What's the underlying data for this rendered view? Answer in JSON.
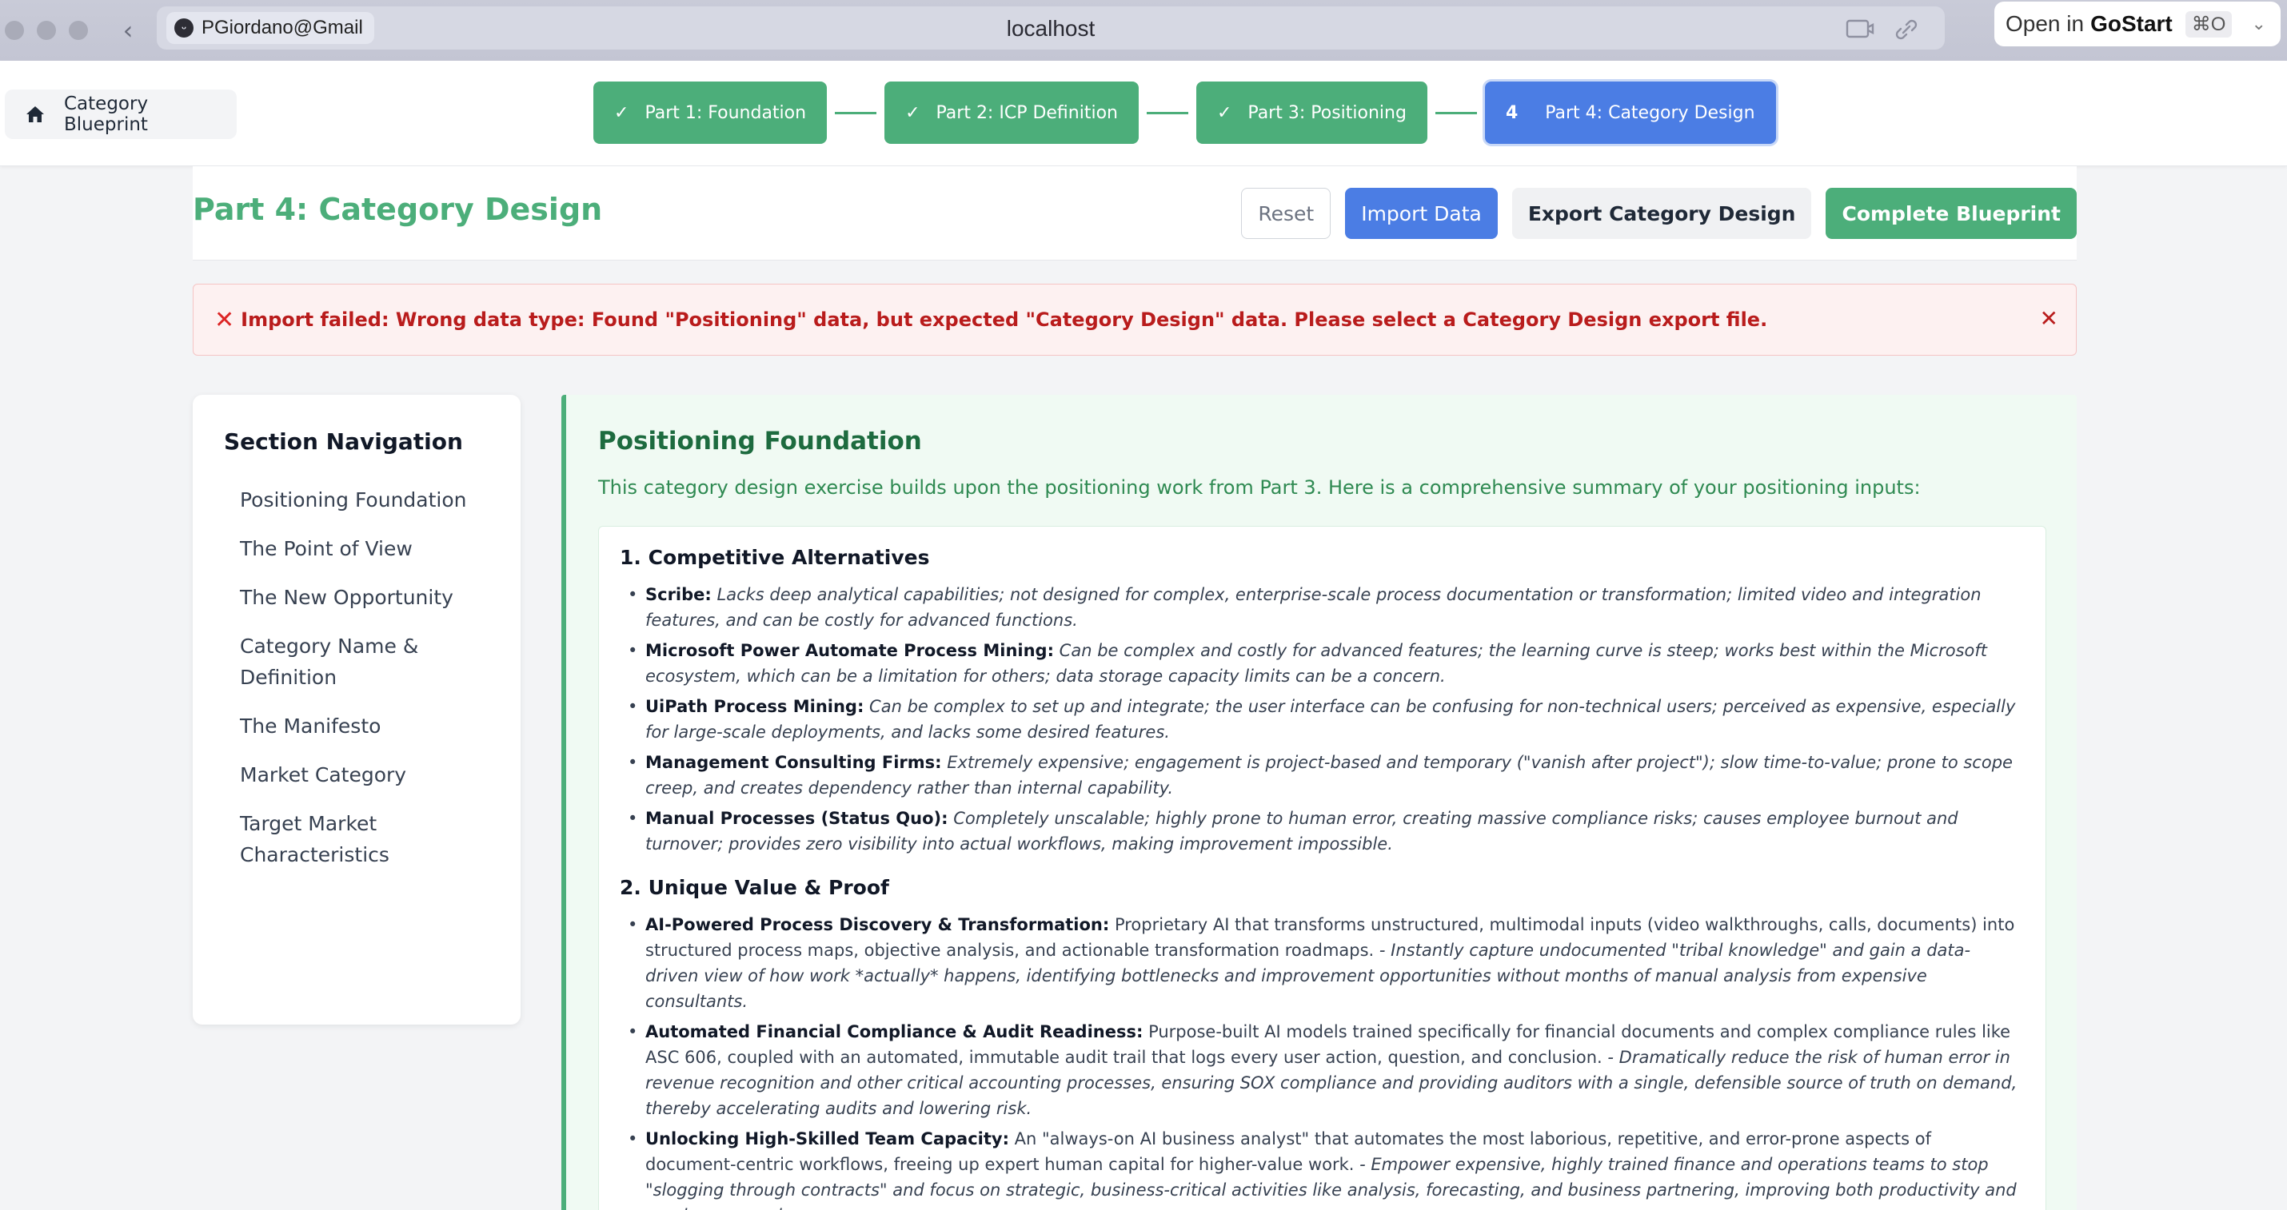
{
  "browser": {
    "profile": "PGiordano@Gmail",
    "url": "localhost",
    "open_in_prefix": "Open in",
    "open_in_app": "GoStart",
    "open_in_shortcut": "⌘O"
  },
  "app": {
    "home_label": "Category Blueprint",
    "steps": [
      {
        "mark": "✓",
        "label": "Part 1: Foundation"
      },
      {
        "mark": "✓",
        "label": "Part 2: ICP Definition"
      },
      {
        "mark": "✓",
        "label": "Part 3: Positioning"
      },
      {
        "mark": "4",
        "label": "Part 4: Category Design"
      }
    ]
  },
  "page": {
    "title": "Part 4: Category Design",
    "reset_label": "Reset",
    "import_label": "Import Data",
    "export_label": "Export Category Design",
    "complete_label": "Complete Blueprint"
  },
  "error": {
    "icon": "✕",
    "message": "Import failed: Wrong data type: Found \"Positioning\" data, but expected \"Category Design\" data. Please select a Category Design export file.",
    "close": "✕"
  },
  "sidebar": {
    "title": "Section Navigation",
    "items": [
      "Positioning Foundation",
      "The Point of View",
      "The New Opportunity",
      "Category Name & Definition",
      "The Manifesto",
      "Market Category",
      "Target Market Characteristics"
    ]
  },
  "main": {
    "title": "Positioning Foundation",
    "intro": "This category design exercise builds upon the positioning work from Part 3. Here is a comprehensive summary of your positioning inputs:",
    "sections": [
      {
        "heading": "1. Competitive Alternatives",
        "items": [
          {
            "name": "Scribe:",
            "text": "",
            "italic": "Lacks deep analytical capabilities; not designed for complex, enterprise-scale process documentation or transformation; limited video and integration features, and can be costly for advanced functions."
          },
          {
            "name": "Microsoft Power Automate Process Mining:",
            "text": "",
            "italic": "Can be complex and costly for advanced features; the learning curve is steep; works best within the Microsoft ecosystem, which can be a limitation for others; data storage capacity limits can be a concern."
          },
          {
            "name": "UiPath Process Mining:",
            "text": "",
            "italic": "Can be complex to set up and integrate; the user interface can be confusing for non-technical users; perceived as expensive, especially for large-scale deployments, and lacks some desired features."
          },
          {
            "name": "Management Consulting Firms:",
            "text": "",
            "italic": "Extremely expensive; engagement is project-based and temporary (\"vanish after project\"); slow time-to-value; prone to scope creep, and creates dependency rather than internal capability."
          },
          {
            "name": "Manual Processes (Status Quo):",
            "text": "",
            "italic": "Completely unscalable; highly prone to human error, creating massive compliance risks; causes employee burnout and turnover; provides zero visibility into actual workflows, making improvement impossible."
          }
        ]
      },
      {
        "heading": "2. Unique Value & Proof",
        "items": [
          {
            "name": "AI-Powered Process Discovery & Transformation:",
            "text": "Proprietary AI that transforms unstructured, multimodal inputs (video walkthroughs, calls, documents) into structured process maps, objective analysis, and actionable transformation roadmaps.",
            "italic": "- Instantly capture undocumented \"tribal knowledge\" and gain a data-driven view of how work *actually* happens, identifying bottlenecks and improvement opportunities without months of manual analysis from expensive consultants."
          },
          {
            "name": "Automated Financial Compliance & Audit Readiness:",
            "text": "Purpose-built AI models trained specifically for financial documents and complex compliance rules like ASC 606, coupled with an automated, immutable audit trail that logs every user action, question, and conclusion.",
            "italic": "- Dramatically reduce the risk of human error in revenue recognition and other critical accounting processes, ensuring SOX compliance and providing auditors with a single, defensible source of truth on demand, thereby accelerating audits and lowering risk."
          },
          {
            "name": "Unlocking High-Skilled Team Capacity:",
            "text": "An \"always-on AI business analyst\" that automates the most laborious, repetitive, and error-prone aspects of document-centric workflows, freeing up expert human capital for higher-value work.",
            "italic": "- Empower expensive, highly trained finance and operations teams to stop \"slogging through contracts\" and focus on strategic, business-critical activities like analysis, forecasting, and business partnering, improving both productivity and employee morale."
          }
        ]
      }
    ]
  }
}
